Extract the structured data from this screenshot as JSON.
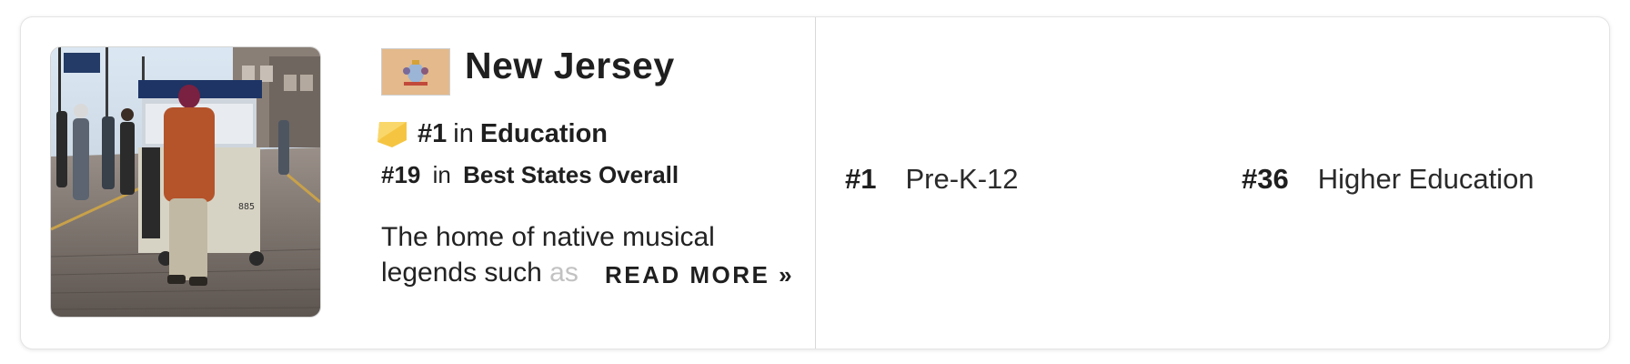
{
  "state": {
    "name": "New Jersey",
    "flag_icon": "new-jersey-flag-icon",
    "photo_icon": "boardwalk-photo"
  },
  "rankings": {
    "main": {
      "rank": "#1",
      "in": "in",
      "category": "Education"
    },
    "overall": {
      "rank": "#19",
      "in": "in",
      "category": "Best States Overall"
    }
  },
  "description": {
    "line1": "The home of native musical",
    "line2_visible": "legends such",
    "line2_faded": " as",
    "read_more": "READ MORE »"
  },
  "sub_rankings": [
    {
      "rank": "#1",
      "label": "Pre-K-12"
    },
    {
      "rank": "#36",
      "label": "Higher Education"
    }
  ],
  "colors": {
    "flag_background": "#e4b98b",
    "badge": "#f5c542"
  }
}
